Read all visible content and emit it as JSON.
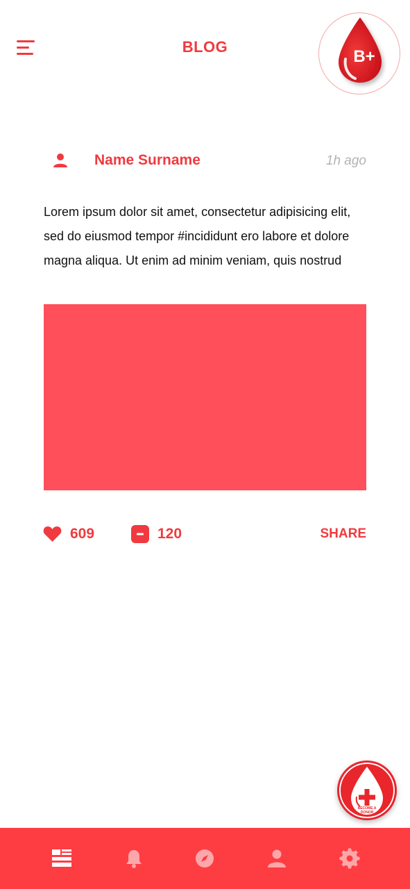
{
  "header": {
    "title": "BLOG",
    "blood_type": "B+"
  },
  "post": {
    "author": "Name Surname",
    "time": "1h ago",
    "body_lines": [
      "Lorem ipsum dolor sit amet, consectetur adipisicing elit,",
      "sed do eiusmod tempor #incididunt ero labore et dolore",
      "magna aliqua. Ut enim ad minim veniam, quis nostrud"
    ],
    "likes": "609",
    "comments": "120",
    "share_label": "SHARE"
  },
  "fab": {
    "label_line1": "BECOME A",
    "label_line2": "DONOR"
  },
  "bottom_nav": {
    "items": [
      {
        "icon": "blog-grid-icon",
        "active": true
      },
      {
        "icon": "bell-icon",
        "active": false
      },
      {
        "icon": "compass-icon",
        "active": false
      },
      {
        "icon": "user-icon",
        "active": false
      },
      {
        "icon": "gear-icon",
        "active": false
      }
    ]
  },
  "colors": {
    "accent": "#f03a3f",
    "image_placeholder": "#fe4f5b",
    "nav_background": "#fe3d43",
    "muted_text": "#b3b3b3"
  }
}
